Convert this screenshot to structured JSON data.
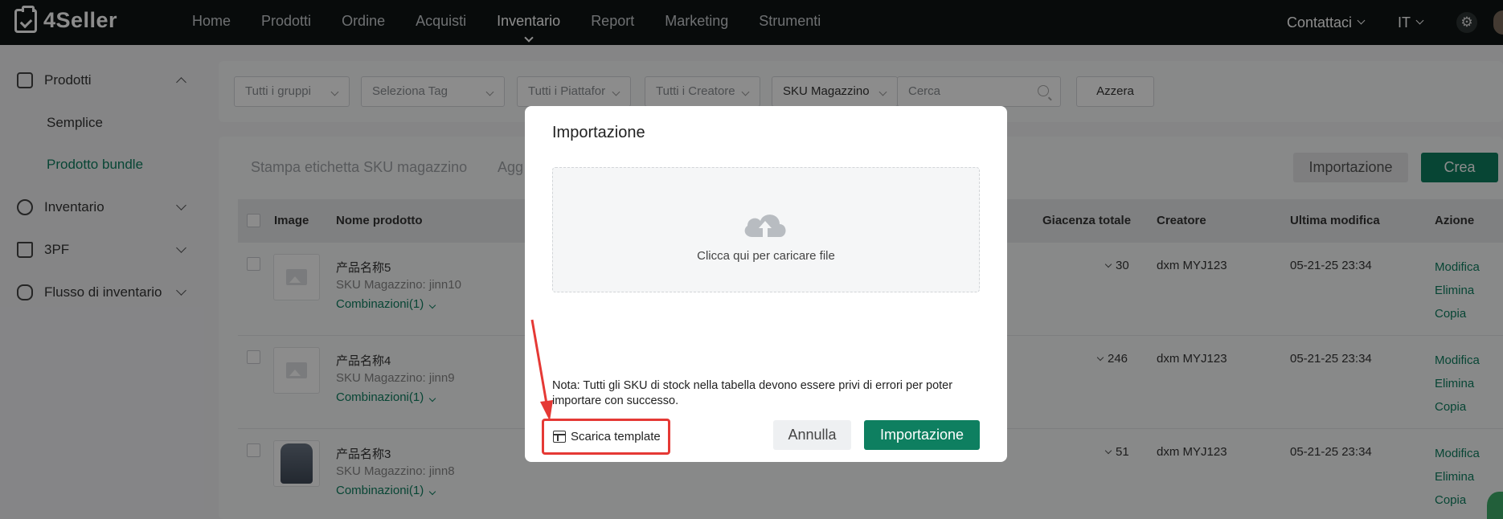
{
  "app": {
    "logo_text": "4Seller"
  },
  "nav": {
    "items": [
      "Home",
      "Prodotti",
      "Ordine",
      "Acquisti",
      "Inventario",
      "Report",
      "Marketing",
      "Strumenti"
    ],
    "active": "Inventario",
    "contact": "Contattaci",
    "language": "IT"
  },
  "sidebar": {
    "groups": [
      {
        "label": "Prodotti",
        "expanded": true
      },
      {
        "label": "Inventario",
        "expanded": false
      },
      {
        "label": "3PF",
        "expanded": false
      },
      {
        "label": "Flusso di inventario",
        "expanded": false
      }
    ],
    "subitems": [
      "Semplice",
      "Prodotto bundle"
    ],
    "active_subitem": "Prodotto bundle"
  },
  "filters": {
    "groups": "Tutti i gruppi",
    "tag": "Seleziona Tag",
    "platform": "Tutti i Piattafor",
    "creator": "Tutti i Creatore",
    "search_field": "SKU Magazzino",
    "search_placeholder": "Cerca",
    "reset": "Azzera"
  },
  "toolbar": {
    "print_label": "Stampa etichetta SKU magazzino",
    "partial_label": "Agg",
    "import_label": "Importazione",
    "create_label": "Crea"
  },
  "table": {
    "headers": {
      "image": "Image",
      "name": "Nome prodotto",
      "stock": "Giacenza totale",
      "creator": "Creatore",
      "modified": "Ultima modifica",
      "action": "Azione"
    },
    "rows": [
      {
        "name": "产品名称5",
        "sku": "SKU Magazzino: jinn10",
        "combos": "Combinazioni(1)",
        "stock": "30",
        "creator": "dxm MYJ123",
        "modified": "05-21-25 23:34",
        "image": "placeholder"
      },
      {
        "name": "产品名称4",
        "sku": "SKU Magazzino: jinn9",
        "combos": "Combinazioni(1)",
        "stock": "246",
        "creator": "dxm MYJ123",
        "modified": "05-21-25 23:34",
        "image": "placeholder"
      },
      {
        "name": "产品名称3",
        "sku": "SKU Magazzino: jinn8",
        "combos": "Combinazioni(1)",
        "stock": "51",
        "creator": "dxm MYJ123",
        "modified": "05-21-25 23:34",
        "image": "jacket"
      }
    ],
    "actions": [
      "Modifica",
      "Elimina",
      "Copia"
    ]
  },
  "modal": {
    "title": "Importazione",
    "upload_text": "Clicca qui per caricare file",
    "note": "Nota: Tutti gli SKU di stock nella tabella devono essere privi di errori per poter importare con successo.",
    "download_label": "Scarica template",
    "cancel_label": "Annulla",
    "import_label": "Importazione"
  },
  "colors": {
    "accent": "#0e7f60",
    "highlight": "#e53935",
    "topbar": "#0f1514"
  }
}
